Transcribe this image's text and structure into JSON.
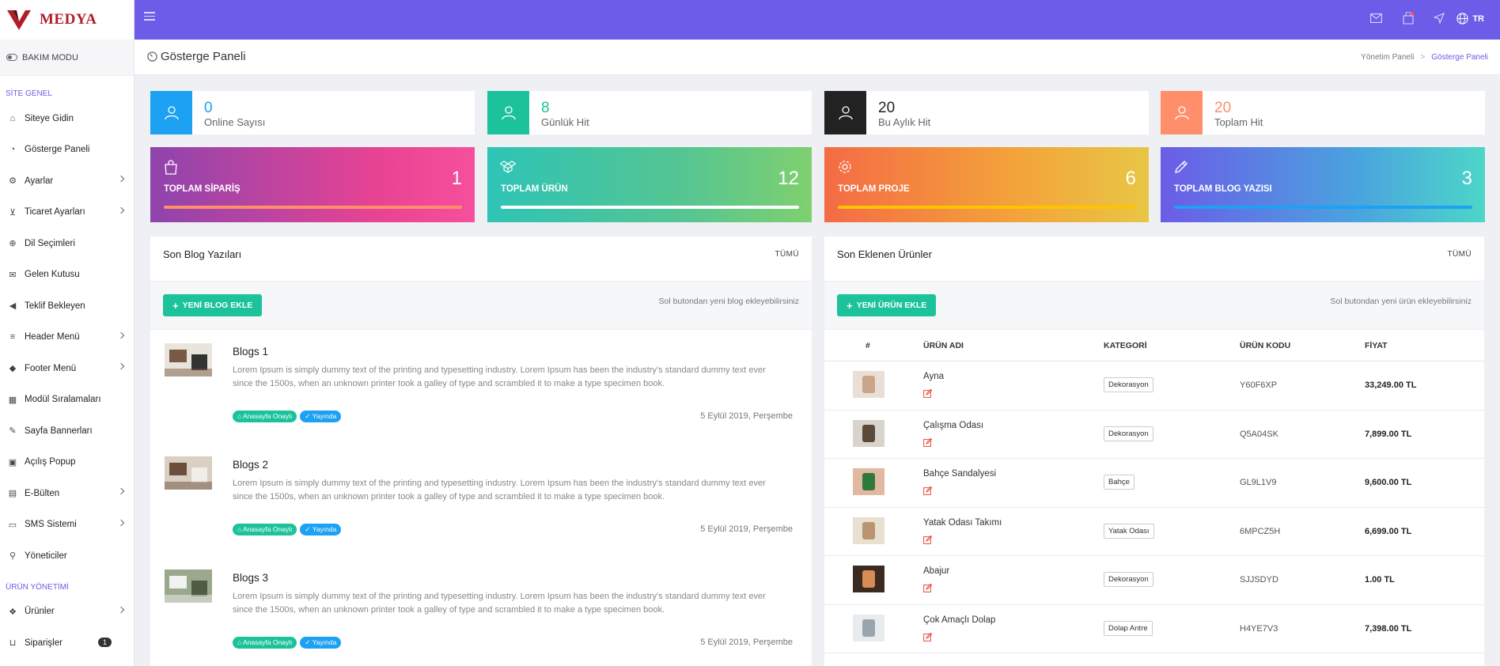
{
  "brand": {
    "name": "MEDYA",
    "color": "#b01e28"
  },
  "accent": "#6c5ce7",
  "sidebar": {
    "maintenance": "BAKIM MODU",
    "sections": [
      {
        "title": "SİTE GENEL"
      },
      {
        "title": "ÜRÜN YÖNETİMİ"
      }
    ],
    "items": [
      {
        "label": "Siteye Gidin",
        "icon": "home-icon"
      },
      {
        "label": "Gösterge Paneli",
        "icon": "gauge-icon"
      },
      {
        "label": "Ayarlar",
        "icon": "gear-icon"
      },
      {
        "label": "Ticaret Ayarları",
        "icon": "cart-icon"
      },
      {
        "label": "Dil Seçimleri",
        "icon": "globe-icon"
      },
      {
        "label": "Gelen Kutusu",
        "icon": "envelope-icon"
      },
      {
        "label": "Teklif Bekleyen",
        "icon": "megaphone-icon"
      },
      {
        "label": "Header Menü",
        "icon": "menu-icon"
      },
      {
        "label": "Footer Menü",
        "icon": "tag-icon"
      },
      {
        "label": "Modül Sıralamaları",
        "icon": "grid-icon"
      },
      {
        "label": "Sayfa Bannerları",
        "icon": "pin-icon"
      },
      {
        "label": "Açılış Popup",
        "icon": "popup-icon"
      },
      {
        "label": "E-Bülten",
        "icon": "newsletter-icon"
      },
      {
        "label": "SMS Sistemi",
        "icon": "sms-icon"
      },
      {
        "label": "Yöneticiler",
        "icon": "user-icon"
      },
      {
        "label": "Ürünler",
        "icon": "dropbox-icon"
      },
      {
        "label": "Siparişler",
        "icon": "bag-icon",
        "badge": "1"
      }
    ]
  },
  "topbar": {
    "lang": "TR"
  },
  "page": {
    "title": "Gösterge Paneli",
    "breadcrumb": [
      "Yönetim Paneli",
      "Gösterge Paneli"
    ]
  },
  "stats": [
    {
      "value": "0",
      "label": "Online Sayısı",
      "color": "#1da1f2"
    },
    {
      "value": "8",
      "label": "Günlük Hit",
      "color": "#1cc39a"
    },
    {
      "value": "20",
      "label": "Bu Aylık Hit",
      "color": "#222222"
    },
    {
      "value": "20",
      "label": "Toplam Hit",
      "color": "#ff8f6b"
    }
  ],
  "totals": [
    {
      "label": "TOPLAM SİPARİŞ",
      "value": "1",
      "icon": "bag-icon"
    },
    {
      "label": "TOPLAM ÜRÜN",
      "value": "12",
      "icon": "dropbox-icon"
    },
    {
      "label": "TOPLAM PROJE",
      "value": "6",
      "icon": "gear-icon"
    },
    {
      "label": "TOPLAM BLOG YAZISI",
      "value": "3",
      "icon": "pencil-icon"
    }
  ],
  "blog_panel": {
    "title": "Son Blog Yazıları",
    "all": "TÜMÜ",
    "add_button": "YENİ BLOG EKLE",
    "hint": "Sol butondan yeni blog ekleyebilirsiniz",
    "tag_home": "Anasayfa Onaylı",
    "tag_live": "Yayında",
    "posts": [
      {
        "title": "Blogs 1",
        "desc": "Lorem Ipsum is simply dummy text of the printing and typesetting industry. Lorem Ipsum has been the industry's standard dummy text ever since the 1500s, when an unknown printer took a galley of type and scrambled it to make a type specimen book.",
        "date": "5 Eylül 2019, Perşembe"
      },
      {
        "title": "Blogs 2",
        "desc": "Lorem Ipsum is simply dummy text of the printing and typesetting industry. Lorem Ipsum has been the industry's standard dummy text ever since the 1500s, when an unknown printer took a galley of type and scrambled it to make a type specimen book.",
        "date": "5 Eylül 2019, Perşembe"
      },
      {
        "title": "Blogs 3",
        "desc": "Lorem Ipsum is simply dummy text of the printing and typesetting industry. Lorem Ipsum has been the industry's standard dummy text ever since the 1500s, when an unknown printer took a galley of type and scrambled it to make a type specimen book.",
        "date": "5 Eylül 2019, Perşembe"
      }
    ]
  },
  "product_panel": {
    "title": "Son Eklenen Ürünler",
    "all": "TÜMÜ",
    "add_button": "YENİ ÜRÜN EKLE",
    "hint": "Sol butondan yeni ürün ekleyebilirsiniz",
    "columns": [
      "#",
      "ÜRÜN ADI",
      "KATEGORİ",
      "ÜRÜN KODU",
      "FİYAT"
    ],
    "rows": [
      {
        "name": "Ayna",
        "category": "Dekorasyon",
        "code": "Y60F6XP",
        "price": "33,249.00 TL"
      },
      {
        "name": "Çalışma Odası",
        "category": "Dekorasyon",
        "code": "Q5A04SK",
        "price": "7,899.00 TL"
      },
      {
        "name": "Bahçe Sandalyesi",
        "category": "Bahçe",
        "code": "GL9L1V9",
        "price": "9,600.00 TL"
      },
      {
        "name": "Yatak Odası Takımı",
        "category": "Yatak Odası",
        "code": "6MPCZ5H",
        "price": "6,699.00 TL"
      },
      {
        "name": "Abajur",
        "category": "Dekorasyon",
        "code": "SJJSDYD",
        "price": "1.00 TL"
      },
      {
        "name": "Çok Amaçlı Dolap",
        "category": "Dolap Antre",
        "code": "H4YE7V3",
        "price": "7,398.00 TL"
      }
    ]
  }
}
